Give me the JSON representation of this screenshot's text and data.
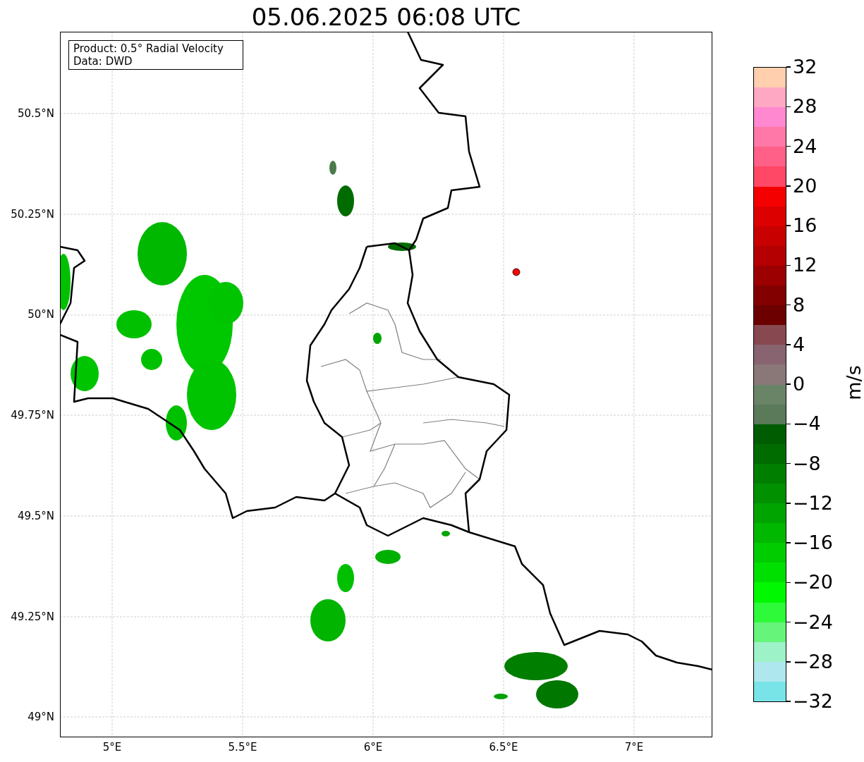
{
  "title": "05.06.2025 06:08 UTC",
  "info_box": {
    "lines": [
      "Product: 0.5° Radial Velocity",
      "Data: DWD"
    ]
  },
  "map": {
    "latitude_labels": [
      "50.5°N",
      "50.25°N",
      "50°N",
      "49.75°N",
      "49.5°N",
      "49.25°N",
      "49°N"
    ],
    "longitude_labels": [
      "5°E",
      "5.5°E",
      "6°E",
      "6.5°E",
      "7°E"
    ]
  },
  "colorbar": {
    "label": "m/s",
    "ticks": [
      "32",
      "28",
      "24",
      "20",
      "16",
      "12",
      "8",
      "4",
      "0",
      "−4",
      "−8",
      "−12",
      "−16",
      "−20",
      "−24",
      "−28",
      "−32"
    ],
    "bins": [
      {
        "color": "#ffcfae"
      },
      {
        "color": "#ffa8c4"
      },
      {
        "color": "#ff88d0"
      },
      {
        "color": "#ff78a8"
      },
      {
        "color": "#ff6088"
      },
      {
        "color": "#ff4866"
      },
      {
        "color": "#f40000"
      },
      {
        "color": "#dc0000"
      },
      {
        "color": "#c80000"
      },
      {
        "color": "#b40000"
      },
      {
        "color": "#9c0000"
      },
      {
        "color": "#820000"
      },
      {
        "color": "#6c0000"
      },
      {
        "color": "#884850"
      },
      {
        "color": "#886470"
      },
      {
        "color": "#8a7878"
      },
      {
        "color": "#6a8468"
      },
      {
        "color": "#5a7a5a"
      },
      {
        "color": "#005c00"
      },
      {
        "color": "#006c00"
      },
      {
        "color": "#007e00"
      },
      {
        "color": "#009000"
      },
      {
        "color": "#00a400"
      },
      {
        "color": "#00b800"
      },
      {
        "color": "#00cc00"
      },
      {
        "color": "#00e000"
      },
      {
        "color": "#00f800"
      },
      {
        "color": "#2efa3a"
      },
      {
        "color": "#66f47a"
      },
      {
        "color": "#9ef2c8"
      },
      {
        "color": "#aee8ee"
      },
      {
        "color": "#78e4e8"
      }
    ]
  }
}
